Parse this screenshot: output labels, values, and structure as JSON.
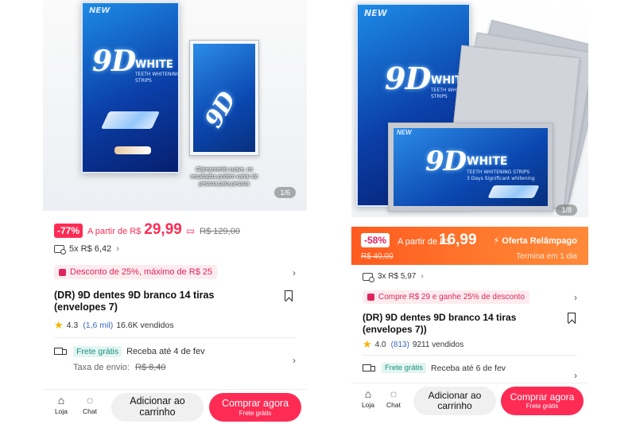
{
  "left": {
    "image": {
      "box_new": "NEW",
      "brand_9d": "9D",
      "brand_white": "WHITE",
      "brand_sub1": "TEETH WHITENING",
      "brand_sub2": "STRIPS",
      "caption": "Clareamento suave, os resultados podem variar de pessoa para pessoa",
      "counter": "1/6"
    },
    "price": {
      "discount_badge": "-77%",
      "from_label": "A partir de R$",
      "current": "29,99",
      "original": "R$ 129,00"
    },
    "installment": "5x R$ 6,42",
    "coupon": "Desconto de 25%, máximo de R$ 25",
    "title": "(DR) 9D dentes 9D branco 14 tiras (envelopes 7)",
    "rating": {
      "score": "4.3",
      "count": "(1,6 mil)",
      "sold": "16.6K vendidos"
    },
    "shipping": {
      "free": "Frete grátis",
      "delivery": "Receba até 4 de fev",
      "fee_label": "Taxa de envio:",
      "fee_old": "R$ 8,40"
    },
    "bar": {
      "store": "Loja",
      "chat": "Chat",
      "cart": "Adicionar ao carrinho",
      "buy": "Comprar agora",
      "buy_sub": "Frete grátis"
    }
  },
  "right": {
    "image": {
      "box_new": "NEW",
      "brand_9d": "9D",
      "brand_white": "WHITE",
      "brand_sub1": "TEETH WHITENING STRIPS",
      "brand_sub2": "STRIPS",
      "env_new": "NEW",
      "env_brand": "9D",
      "env_white": "WHITE",
      "env_sub1": "TEETH WHITENING STRIPS",
      "env_sub2": "3 Days Significant whitening",
      "counter": "1/8"
    },
    "price": {
      "discount_badge": "-58%",
      "from_label": "A partir de R$",
      "current": "16,99",
      "original": "R$ 40,00",
      "offer": "Oferta Relâmpago",
      "ends": "Termina em 1 dia"
    },
    "installment": "3x R$ 5,97",
    "coupon": "Compre R$ 29 e ganhe 25% de desconto",
    "title": "(DR) 9D dentes 9D branco 14 tiras (envelopes 7))",
    "rating": {
      "score": "4.0",
      "count": "(813)",
      "sold": "9211 vendidos"
    },
    "shipping": {
      "free": "Frete grátis",
      "delivery": "Receba até 6 de fev"
    },
    "bar": {
      "store": "Loja",
      "chat": "Chat",
      "cart": "Adicionar ao carrinho",
      "buy": "Comprar agora",
      "buy_sub": "Frete grátis"
    }
  },
  "colors": {
    "accent": "#fe2c55",
    "flash": "#ff6a25",
    "discount_bg": "#fdecef",
    "star": "#f5b301"
  },
  "icons": [
    "store-icon",
    "chat-icon",
    "bookmark-icon",
    "star-icon",
    "truck-icon",
    "card-icon",
    "coupon-icon",
    "chevron-right-icon",
    "lightning-icon"
  ]
}
